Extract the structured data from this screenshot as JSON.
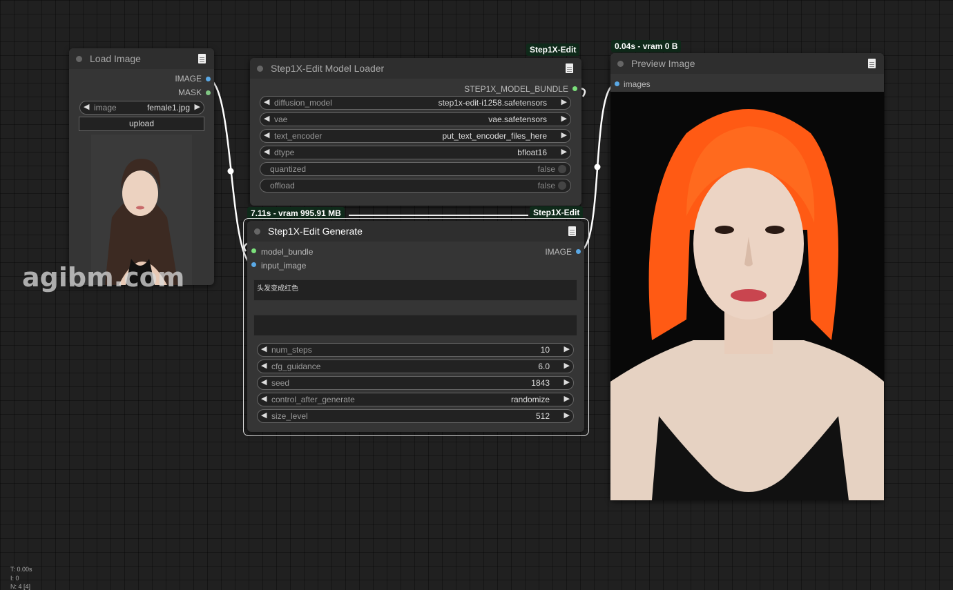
{
  "load_image": {
    "title": "Load Image",
    "outputs": [
      "IMAGE",
      "MASK"
    ],
    "image_widget": {
      "label": "image",
      "value": "female1.jpg"
    },
    "upload_label": "upload"
  },
  "model_loader": {
    "title": "Step1X-Edit Model Loader",
    "badge": "Step1X-Edit",
    "output": "STEP1X_MODEL_BUNDLE",
    "widgets": [
      {
        "label": "diffusion_model",
        "value": "step1x-edit-i1258.safetensors"
      },
      {
        "label": "vae",
        "value": "vae.safetensors"
      },
      {
        "label": "text_encoder",
        "value": "put_text_encoder_files_here"
      },
      {
        "label": "dtype",
        "value": "bfloat16"
      },
      {
        "label": "quantized",
        "value": "false"
      },
      {
        "label": "offload",
        "value": "false"
      }
    ]
  },
  "generate": {
    "title": "Step1X-Edit Generate",
    "timing_badge": "7.11s - vram 995.91 MB",
    "badge": "Step1X-Edit",
    "inputs": [
      "model_bundle",
      "input_image"
    ],
    "output": "IMAGE",
    "prompt": "头发变成红色",
    "negative_prompt": "",
    "widgets": [
      {
        "label": "num_steps",
        "value": "10"
      },
      {
        "label": "cfg_guidance",
        "value": "6.0"
      },
      {
        "label": "seed",
        "value": "1843"
      },
      {
        "label": "control_after_generate",
        "value": "randomize"
      },
      {
        "label": "size_level",
        "value": "512"
      }
    ]
  },
  "preview": {
    "title": "Preview Image",
    "timing_badge": "0.04s - vram 0 B",
    "input": "images"
  },
  "watermark": "agibm.com",
  "stats": {
    "t": "T: 0.00s",
    "i": "I: 0",
    "n": "N: 4 [4]"
  },
  "colors": {
    "image_slot": "#5aa9e6",
    "mask_slot": "#81c784",
    "bundle_slot": "#7be07b",
    "hair": "#ff5a14"
  }
}
